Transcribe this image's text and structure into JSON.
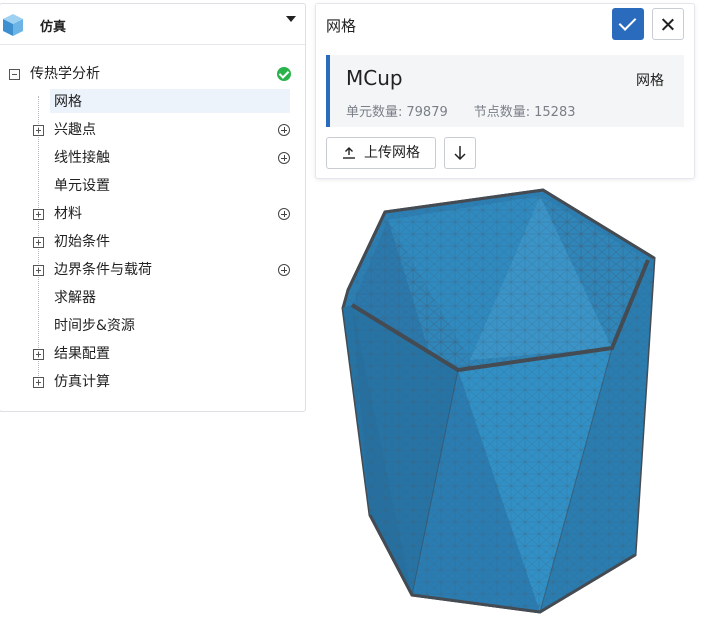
{
  "left_panel": {
    "title": "仿真",
    "tree": [
      {
        "label": "传热学分析",
        "expander": "minus",
        "status": "check"
      },
      {
        "label": "网格",
        "selected": true
      },
      {
        "label": "兴趣点",
        "expander": "plus",
        "action": "add"
      },
      {
        "label": "线性接触",
        "action": "add"
      },
      {
        "label": "单元设置"
      },
      {
        "label": "材料",
        "expander": "plus",
        "action": "add"
      },
      {
        "label": "初始条件",
        "expander": "plus"
      },
      {
        "label": "边界条件与载荷",
        "expander": "plus",
        "action": "add"
      },
      {
        "label": "求解器"
      },
      {
        "label": "时间步&资源"
      },
      {
        "label": "结果配置",
        "expander": "plus"
      },
      {
        "label": "仿真计算",
        "expander": "plus"
      }
    ]
  },
  "mesh_panel": {
    "title": "网格",
    "card": {
      "name": "MCup",
      "type": "网格",
      "element_label": "单元数量:",
      "element_count": "79879",
      "node_label": "节点数量:",
      "node_count": "15283"
    },
    "upload_label": "上传网格"
  },
  "colors": {
    "accent": "#2a6bbd",
    "success": "#2bb34b",
    "mesh_fill": "#2b7fb4",
    "mesh_edge": "#4a4f55"
  },
  "icons": [
    "logo-cube-icon",
    "caret-down-icon",
    "check-circle-icon",
    "add-circle-icon",
    "confirm-check-icon",
    "close-icon",
    "upload-icon",
    "download-arrow-icon"
  ]
}
